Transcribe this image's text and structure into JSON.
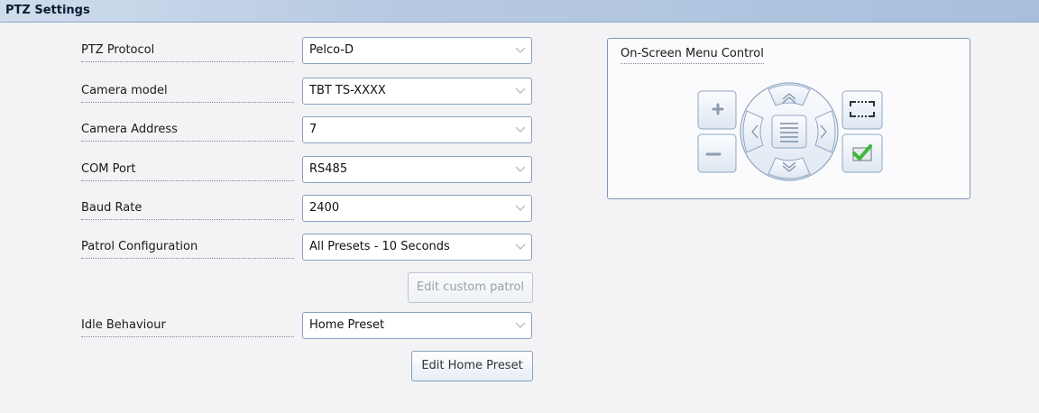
{
  "window": {
    "title": "PTZ Settings"
  },
  "fields": [
    {
      "label": "PTZ Protocol",
      "value": "Pelco-D"
    },
    {
      "label": "Camera model",
      "value": "TBT TS-XXXX"
    },
    {
      "label": "Camera Address",
      "value": "7"
    },
    {
      "label": "COM Port",
      "value": "RS485"
    },
    {
      "label": "Baud Rate",
      "value": "2400"
    },
    {
      "label": "Patrol Configuration",
      "value": "All Presets - 10 Seconds"
    },
    {
      "label": "Idle Behaviour",
      "value": "Home Preset"
    }
  ],
  "buttons": {
    "edit_custom_patrol": "Edit custom patrol",
    "edit_home_preset": "Edit Home Preset"
  },
  "osd": {
    "title": "On-Screen Menu Control",
    "icons": [
      "plus-icon",
      "minus-icon",
      "up-icon",
      "down-icon",
      "left-icon",
      "right-icon",
      "menu-icon",
      "fullscreen-icon",
      "confirm-icon"
    ]
  },
  "colors": {
    "border": "#8aa0bf",
    "confirm": "#3cb83c"
  }
}
